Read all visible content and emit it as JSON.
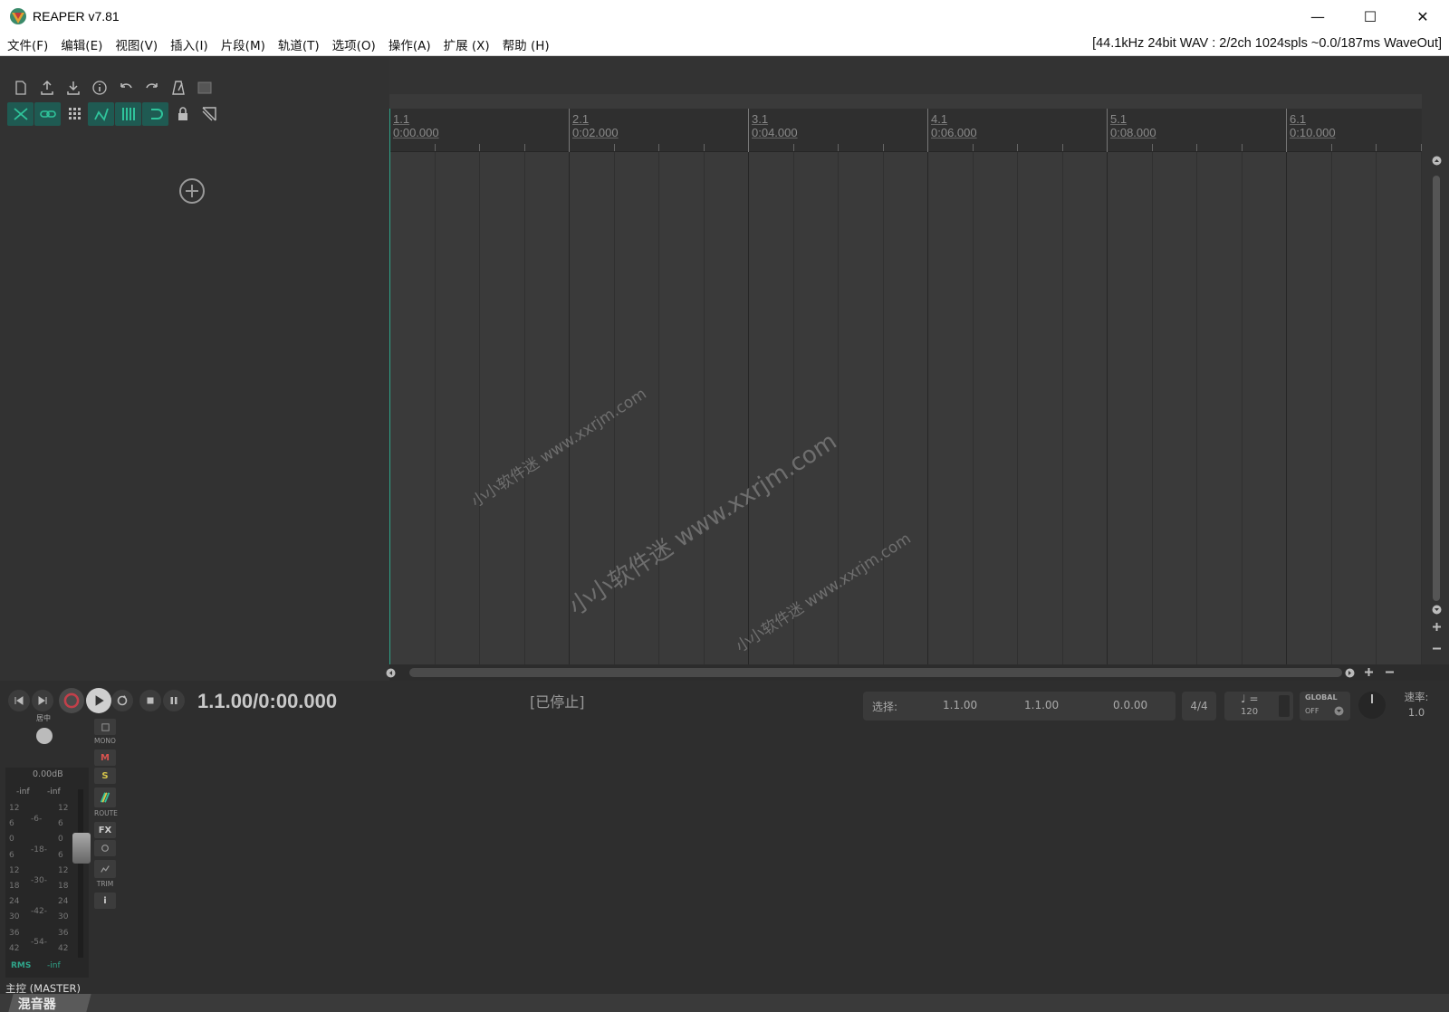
{
  "window": {
    "title": "REAPER v7.81",
    "minimize": "—",
    "maximize": "☐",
    "close": "✕"
  },
  "menu": {
    "items": [
      "文件(F)",
      "编辑(E)",
      "视图(V)",
      "插入(I)",
      "片段(M)",
      "轨道(T)",
      "选项(O)",
      "操作(A)",
      "扩展 (X)",
      "帮助 (H)"
    ],
    "audio_status": "[44.1kHz 24bit WAV : 2/2ch 1024spls ~0.0/187ms WaveOut]"
  },
  "ruler": {
    "markers": [
      {
        "bar": "1.1",
        "time": "0:00.000"
      },
      {
        "bar": "2.1",
        "time": "0:02.000"
      },
      {
        "bar": "3.1",
        "time": "0:04.000"
      },
      {
        "bar": "4.1",
        "time": "0:06.000"
      },
      {
        "bar": "5.1",
        "time": "0:08.000"
      },
      {
        "bar": "6.1",
        "time": "0:10.000"
      }
    ]
  },
  "transport": {
    "position": "1.1.00/0:00.000",
    "state": "[已停止]",
    "selection_label": "选择:",
    "sel_start": "1.1.00",
    "sel_end": "1.1.00",
    "sel_length": "0.0.00",
    "time_signature": "4/4",
    "bpm_label": "♩ =",
    "bpm": "120",
    "global_label": "GLOBAL",
    "global_state": "OFF",
    "rate_label": "速率:",
    "rate_value": "1.0"
  },
  "master": {
    "pan_label": "居中",
    "mono_label": "MONO",
    "mute_label": "M",
    "solo_label": "S",
    "route_label": "ROUTE",
    "fx_label": "FX",
    "trim_label": "TRIM",
    "info_label": "i",
    "volume": "0.00dB",
    "peak_left": "-inf",
    "peak_right": "-inf",
    "rms_label": "RMS",
    "rms_value": "-inf",
    "name": "主控 (MASTER)",
    "scale_outer": [
      "12",
      "6",
      "0",
      "6",
      "12",
      "18",
      "24",
      "30",
      "36",
      "42"
    ],
    "scale_inner": [
      "-6-",
      "-18-",
      "-30-",
      "-42-",
      "-54-"
    ]
  },
  "bottom": {
    "mixer_tab": "混音器"
  },
  "watermarks": [
    "小小软件迷  www.xxrjm.com",
    "小小软件迷  www.xxrjm.com",
    "小小软件迷  www.xxrjm.com"
  ],
  "colors": {
    "accent": "#2fa58a",
    "record": "#c2404a",
    "mute": "#d9534f",
    "solo": "#d6c54a"
  }
}
